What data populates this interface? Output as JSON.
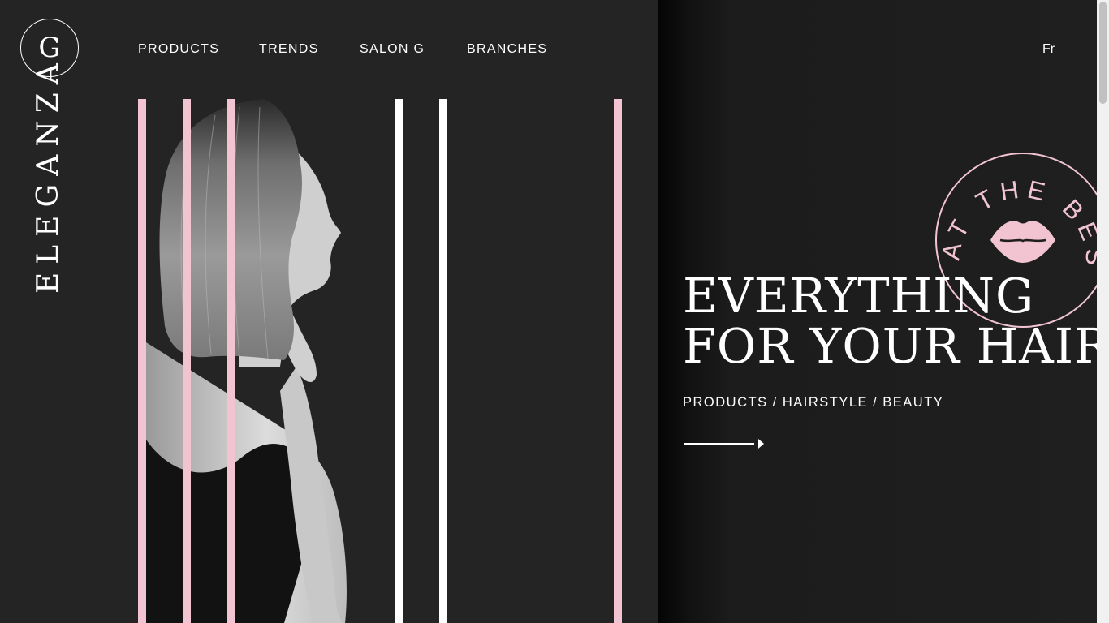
{
  "brand": {
    "logo_letter": "G",
    "name": "ELEGANZA"
  },
  "nav": {
    "items": [
      {
        "label": "PRODUCTS"
      },
      {
        "label": "TRENDS"
      },
      {
        "label": "SALON G"
      },
      {
        "label": "BRANCHES"
      }
    ],
    "language": "Fr"
  },
  "hero": {
    "title_line1": "EVERYTHING",
    "title_line2": "FOR YOUR HAIR",
    "subtitle": "PRODUCTS / HAIRSTYLE / BEAUTY",
    "cta_icon": "arrow-right-icon"
  },
  "badge": {
    "text": "AT THE BEST PRICE!",
    "icon": "lips-icon"
  },
  "colors": {
    "background": "#232323",
    "accent_pink": "#f2c4d1",
    "text": "#ffffff"
  }
}
